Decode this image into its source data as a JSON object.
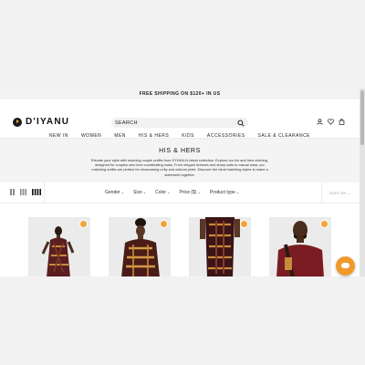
{
  "banner": {
    "text": "FREE SHIPPING ON $120+ IN US"
  },
  "header": {
    "logo_text": "D'IYANU",
    "search": {
      "placeholder": "SEARCH"
    },
    "icons": [
      "account-icon",
      "heart-icon",
      "bag-icon"
    ]
  },
  "nav": {
    "items": [
      {
        "label": "NEW IN"
      },
      {
        "label": "WOMEN"
      },
      {
        "label": "MEN"
      },
      {
        "label": "HIS & HERS"
      },
      {
        "label": "KIDS"
      },
      {
        "label": "ACCESSORIES"
      },
      {
        "label": "SALE & CLEARANCE"
      }
    ]
  },
  "hero": {
    "title": "HIS & HERS",
    "description": "Elevate your style with stunning couple outfits from D'IYANU's latest collection. Explore our his and hers clothing, designed for couples who love coordinating looks. From elegant dresses and sharp suits to casual wear, our matching outfits are perfect for showcasing unity and cultural pride. Discover the ideal matching styles to make a statement together."
  },
  "filters": {
    "items": [
      {
        "label": "Gender"
      },
      {
        "label": "Size"
      },
      {
        "label": "Color"
      },
      {
        "label": "Price ($)"
      },
      {
        "label": "Product type"
      }
    ],
    "sort_label": "SORT BY"
  },
  "colors": {
    "accent": "#f2a33a",
    "chat": "#f09a2c",
    "header_bg": "#ffffff",
    "hero_bg": "#f4f4f4"
  }
}
